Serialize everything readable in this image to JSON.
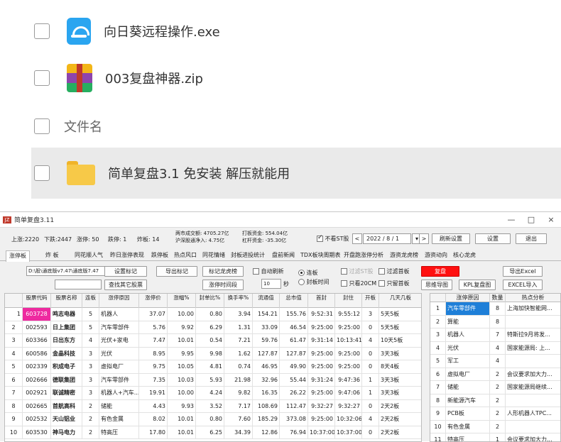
{
  "explorer": {
    "files": [
      {
        "name": "向日葵远程操作.exe",
        "icon": "sunflower-exe-icon"
      },
      {
        "name": "003复盘神器.zip",
        "icon": "winrar-zip-icon"
      }
    ],
    "header": "文件名",
    "folder": {
      "name": "简单复盘3.1 免安装 解压就能用",
      "icon": "folder-icon"
    }
  },
  "app": {
    "title": "简单复盘3.11",
    "logo": "JZ",
    "window_buttons": {
      "minimize": "—",
      "maximize": "□",
      "close": "×"
    },
    "stats": {
      "up": "上涨:2220",
      "down": "下跌:2447",
      "limit_up": "涨停: 50",
      "limit_down": "跌停: 1",
      "broken": "炸板: 14",
      "turnover": "两市成交额: 4705.27亿",
      "northbound": "沪深股通净入: 4.75亿",
      "board_funds": "打板资金: 554.04亿",
      "lever_funds": "杠杆资金: -35.30亿",
      "no_st_label": "不看ST股",
      "date": "2022 / 8 / 1",
      "refresh_label": "刷新设置",
      "settings_label": "设置",
      "exit_label": "退出"
    },
    "tabs": [
      "涨停板",
      "炸 板",
      "同花顺人气",
      "昨日涨停表现",
      "跌停板",
      "热点风口",
      "同花情绪",
      "封板进投统计",
      "盘前新闻",
      "TDX板块周期表",
      "开盘跑涨停分析",
      "游资龙虎榜",
      "游资动向",
      "核心龙虎"
    ],
    "controls": {
      "path": "D:\\股\\通底版v7.47\\通底版7.47",
      "set_tag": "设置标记",
      "find_other": "查找其它股票",
      "export_tag": "导出标记",
      "tag_dragon": "标记龙虎榜",
      "limit_time": "涨停时间段",
      "auto_refresh": "自动刷新",
      "interval": "10",
      "seconds": "秒",
      "lianban": "连板",
      "seal_time": "封板时间",
      "filter_st": "过滤ST股",
      "only_20cm": "只看20CM",
      "filter_first": "过滤首板",
      "only_first": "只留首板",
      "fupan": "复盘",
      "mindmap": "思维导图",
      "kpl": "KPL复盘图",
      "export_excel": "导出Excel",
      "import_excel": "EXCEL导入"
    },
    "table": {
      "headers": [
        "",
        "股票代码",
        "股票名称",
        "连板",
        "涨停原因",
        "涨停价",
        "涨幅%",
        "封单比%",
        "换手率%",
        "流通值",
        "总市值",
        "首封",
        "封住",
        "开板",
        "几天几板"
      ],
      "rows": [
        [
          "1",
          "603728",
          "鸣志电器",
          "5",
          "机器人",
          "37.07",
          "10.00",
          "0.80",
          "3.94",
          "154.21",
          "155.76",
          "9:52:31",
          "9:55:12",
          "3",
          "5天5板"
        ],
        [
          "2",
          "002593",
          "日上集团",
          "5",
          "汽车零部件",
          "5.76",
          "9.92",
          "6.29",
          "1.31",
          "33.09",
          "46.54",
          "9:25:00",
          "9:25:00",
          "0",
          "5天5板"
        ],
        [
          "3",
          "603366",
          "日出东方",
          "4",
          "光伏+家电",
          "7.47",
          "10.01",
          "0.54",
          "7.21",
          "59.76",
          "61.47",
          "9:31:14",
          "10:13:41",
          "4",
          "10天5板"
        ],
        [
          "4",
          "600586",
          "金晶科技",
          "3",
          "光伏",
          "8.95",
          "9.95",
          "9.98",
          "1.62",
          "127.87",
          "127.87",
          "9:25:00",
          "9:25:00",
          "0",
          "3天3板"
        ],
        [
          "5",
          "002339",
          "积成电子",
          "3",
          "虚拟电厂",
          "9.75",
          "10.05",
          "4.81",
          "0.74",
          "46.95",
          "49.90",
          "9:25:00",
          "9:25:00",
          "0",
          "8天4板"
        ],
        [
          "6",
          "002666",
          "德联集团",
          "3",
          "汽车零部件",
          "7.35",
          "10.03",
          "5.93",
          "21.98",
          "32.96",
          "55.44",
          "9:31:24",
          "9:47:36",
          "1",
          "3天3板"
        ],
        [
          "7",
          "002921",
          "联诚精密",
          "3",
          "机器人+汽车...",
          "19.91",
          "10.00",
          "4.24",
          "9.82",
          "16.35",
          "26.22",
          "9:25:00",
          "9:47:06",
          "1",
          "3天3板"
        ],
        [
          "8",
          "002665",
          "首航高科",
          "2",
          "储能",
          "4.43",
          "9.93",
          "3.52",
          "7.17",
          "108.69",
          "112.47",
          "9:32:27",
          "9:32:27",
          "0",
          "2天2板"
        ],
        [
          "9",
          "002532",
          "天山铝业",
          "2",
          "有色金属",
          "8.02",
          "10.01",
          "0.80",
          "7.60",
          "185.29",
          "373.08",
          "9:25:00",
          "10:32:06",
          "4",
          "2天2板"
        ],
        [
          "10",
          "603530",
          "神马电力",
          "2",
          "特高压",
          "17.80",
          "10.01",
          "6.25",
          "34.39",
          "12.86",
          "76.94",
          "10:37:00",
          "10:37:00",
          "0",
          "2天2板"
        ]
      ]
    },
    "side_table": {
      "headers": [
        "",
        "涨停原因",
        "数量",
        "热点分析"
      ],
      "rows": [
        [
          "1",
          "汽车零部件",
          "8",
          "上海加快智能网..."
        ],
        [
          "2",
          "算能",
          "8",
          ""
        ],
        [
          "3",
          "机器人",
          "7",
          "特斯拉9月将发..."
        ],
        [
          "4",
          "光伏",
          "4",
          "国家能源局: 上..."
        ],
        [
          "5",
          "军工",
          "4",
          ""
        ],
        [
          "6",
          "虚拟电厂",
          "2",
          "会议要求加大力..."
        ],
        [
          "7",
          "储能",
          "2",
          "国家能源局继续..."
        ],
        [
          "8",
          "新能源汽车",
          "2",
          ""
        ],
        [
          "9",
          "PCB板",
          "2",
          "人形机器人TPC..."
        ],
        [
          "10",
          "有色金属",
          "2",
          ""
        ],
        [
          "11",
          "特高压",
          "1",
          "会议要求加大力..."
        ]
      ]
    },
    "colors": {
      "highlight_code": "#ee2aa0",
      "fupan_button": "#ff1010",
      "selected_row": "#1e7fd8"
    }
  }
}
